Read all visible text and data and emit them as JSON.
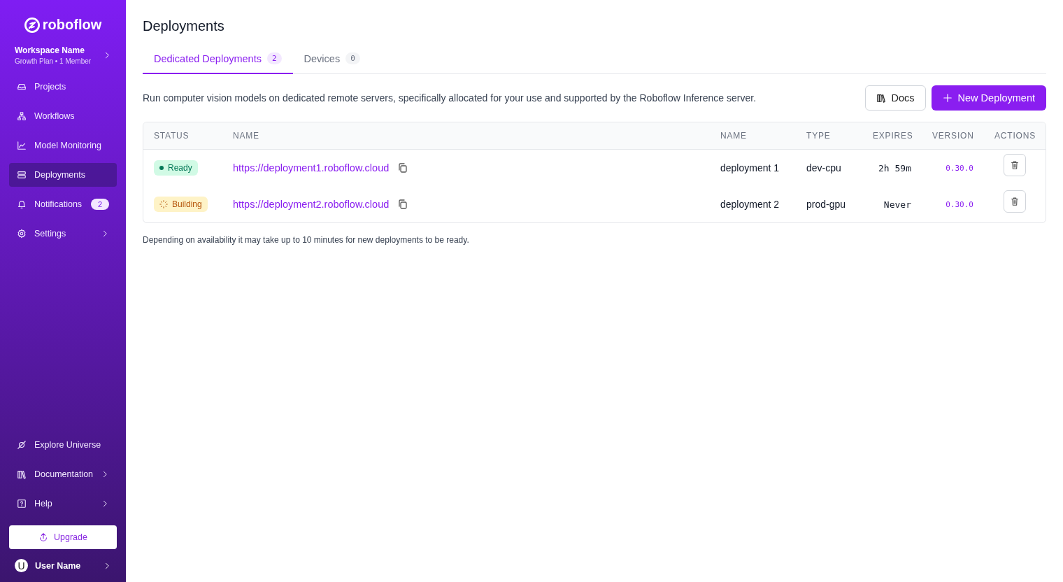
{
  "sidebar": {
    "logo": "roboflow",
    "workspace": {
      "name": "Workspace Name",
      "plan": "Growth Plan • 1 Member"
    },
    "items": [
      {
        "label": "Projects",
        "selected": false,
        "has_submenu": false
      },
      {
        "label": "Workflows",
        "selected": false,
        "has_submenu": false
      },
      {
        "label": "Model Monitoring",
        "selected": false,
        "has_submenu": false
      },
      {
        "label": "Deployments",
        "selected": true,
        "has_submenu": false
      },
      {
        "label": "Notifications",
        "selected": false,
        "has_submenu": false,
        "badge": "2"
      },
      {
        "label": "Settings",
        "selected": false,
        "has_submenu": true
      }
    ],
    "bottom_items": [
      {
        "label": "Explore Universe",
        "has_submenu": false
      },
      {
        "label": "Documentation",
        "has_submenu": true
      },
      {
        "label": "Help",
        "has_submenu": true
      }
    ],
    "upgrade_button": "Upgrade",
    "user": {
      "initial": "U",
      "name": "User Name"
    }
  },
  "page": {
    "title": "Deployments",
    "tabs": [
      {
        "label": "Dedicated Deployments",
        "count": "2",
        "selected": true
      },
      {
        "label": "Devices",
        "count": "0",
        "selected": false
      }
    ],
    "description": "Run computer vision models on dedicated remote servers, specifically allocated for your use and supported by the Roboflow Inference server.",
    "buttons": {
      "docs": "Docs",
      "new": "New Deployment"
    },
    "table": {
      "columns": [
        "STATUS",
        "NAME",
        "NAME",
        "TYPE",
        "EXPIRES",
        "VERSION",
        "ACTIONS"
      ],
      "rows": [
        {
          "status": {
            "kind": "ready",
            "label": "Ready"
          },
          "url": "https://deployment1.roboflow.cloud",
          "name": "deployment 1",
          "type": "dev-cpu",
          "expires": "2h 59m",
          "version": "0.30.0"
        },
        {
          "status": {
            "kind": "building",
            "label": "Building"
          },
          "url": "https://deployment2.roboflow.cloud",
          "name": "deployment 2",
          "type": "prod-gpu",
          "expires": "Never",
          "version": "0.30.0"
        }
      ]
    },
    "footnote": "Depending on availability it may take up to 10 minutes for new deployments to be ready."
  }
}
